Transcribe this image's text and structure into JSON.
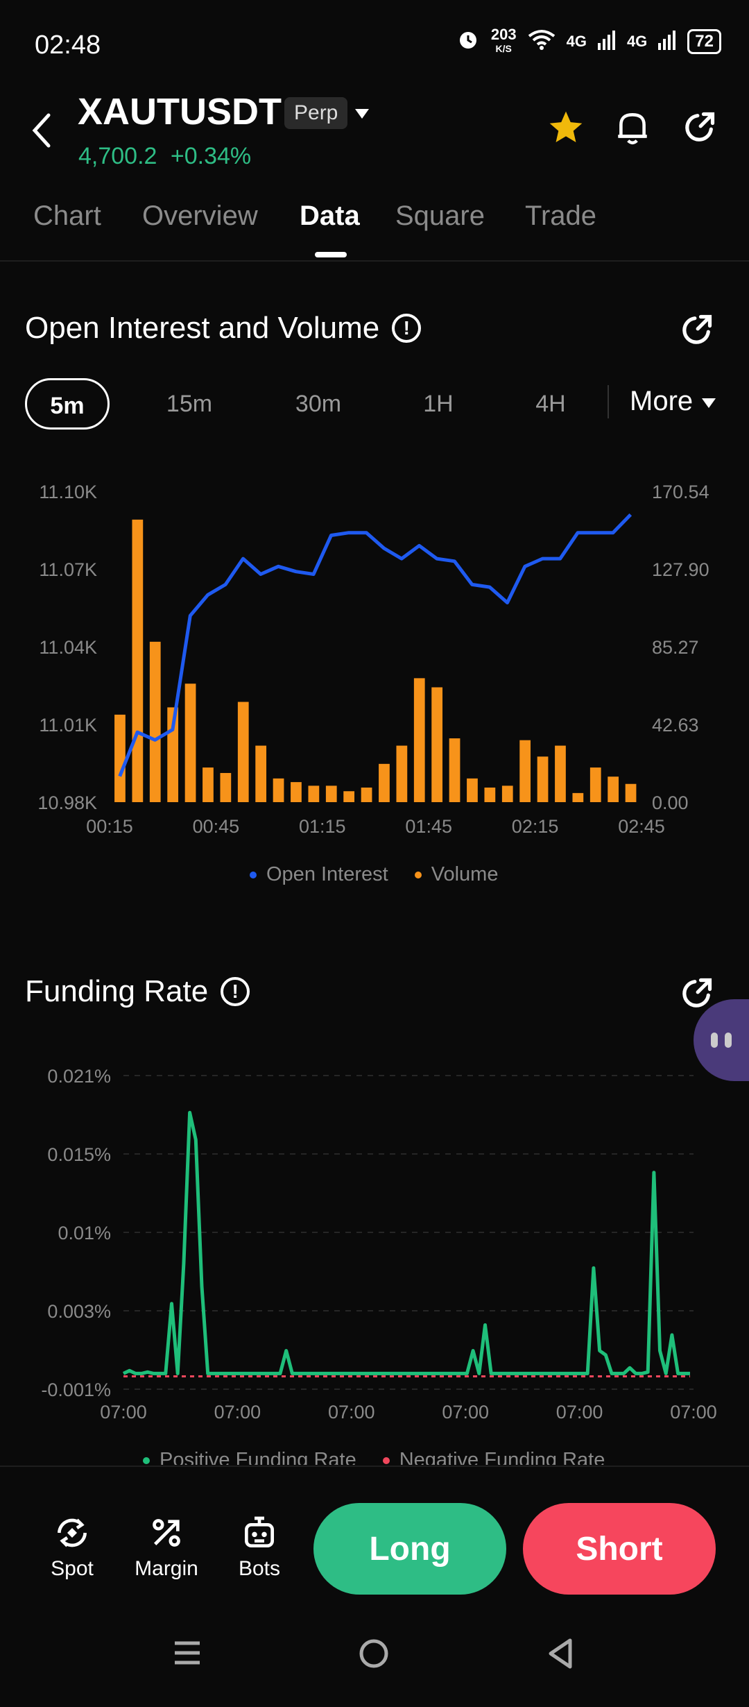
{
  "status": {
    "time": "02:48",
    "speed_top": "203",
    "speed_bottom": "K/S",
    "net1": "4G",
    "net2": "4G",
    "battery": "72"
  },
  "header": {
    "symbol": "XAUTUSDT",
    "badge": "Perp",
    "price": "4,700.2",
    "change": "+0.34%"
  },
  "tabs": [
    "Chart",
    "Overview",
    "Data",
    "Square",
    "Trade"
  ],
  "active_tab": "Data",
  "oi_section": {
    "title": "Open Interest and Volume",
    "intervals": [
      "5m",
      "15m",
      "30m",
      "1H",
      "4H"
    ],
    "active_interval": "5m",
    "more_label": "More"
  },
  "chart_data": [
    {
      "type": "bar+line",
      "x_ticks": [
        "00:15",
        "00:45",
        "01:15",
        "01:45",
        "02:15",
        "02:45"
      ],
      "left_axis_ticks": [
        "11.10K",
        "11.07K",
        "11.04K",
        "11.01K",
        "10.98K"
      ],
      "right_axis_ticks": [
        "170.54",
        "127.90",
        "85.27",
        "42.63",
        "0.00"
      ],
      "ylim_left": [
        10980,
        11100
      ],
      "ylim_right": [
        0,
        170.54
      ],
      "series": [
        {
          "name": "Open Interest",
          "axis": "left",
          "color": "#1f5af0",
          "values": [
            10990,
            11007,
            11004,
            11008,
            11052,
            11060,
            11064,
            11074,
            11068,
            11071,
            11069,
            11068,
            11083,
            11084,
            11084,
            11078,
            11074,
            11079,
            11074,
            11073,
            11064,
            11063,
            11057,
            11071,
            11074,
            11074,
            11084,
            11084,
            11084,
            11091
          ]
        },
        {
          "name": "Volume",
          "axis": "right",
          "color": "#f7931a",
          "values": [
            48,
            155,
            88,
            52,
            65,
            19,
            16,
            55,
            31,
            13,
            11,
            9,
            9,
            6,
            8,
            21,
            31,
            68,
            63,
            35,
            13,
            8,
            9,
            34,
            25,
            31,
            5,
            19,
            14,
            10
          ]
        }
      ]
    },
    {
      "type": "line",
      "x_ticks": [
        "07:00",
        "07:00",
        "07:00",
        "07:00",
        "07:00",
        "07:00"
      ],
      "y_ticks": [
        "0.021%",
        "0.015%",
        "0.01%",
        "0.003%",
        "-0.001%"
      ],
      "ylim": [
        -0.001,
        0.021
      ],
      "series": [
        {
          "name": "Positive Funding Rate",
          "color": "#1fbf7a",
          "values": [
            0.0001,
            0.0003,
            0.0001,
            0.0001,
            0.0002,
            0.0001,
            0.0001,
            0.0001,
            0.005,
            0.0001,
            0.0078,
            0.0184,
            0.0165,
            0.0062,
            0.0001,
            0.0001,
            0.0001,
            0.0001,
            0.0001,
            0.0001,
            0.0001,
            0.0001,
            0.0001,
            0.0001,
            0.0001,
            0.0001,
            0.0001,
            0.0017,
            0.0001,
            0.0001,
            0.0001,
            0.0001,
            0.0001,
            0.0001,
            0.0001,
            0.0001,
            0.0001,
            0.0001,
            0.0001,
            0.0001,
            0.0001,
            0.0001,
            0.0001,
            0.0001,
            0.0001,
            0.0001,
            0.0001,
            0.0001,
            0.0001,
            0.0001,
            0.0001,
            0.0001,
            0.0001,
            0.0001,
            0.0001,
            0.0001,
            0.0001,
            0.0001,
            0.0017,
            0.0001,
            0.0035,
            0.0001,
            0.0001,
            0.0001,
            0.0001,
            0.0001,
            0.0001,
            0.0001,
            0.0001,
            0.0001,
            0.0001,
            0.0001,
            0.0001,
            0.0001,
            0.0001,
            0.0001,
            0.0001,
            0.0001,
            0.0075,
            0.0017,
            0.0014,
            0.0001,
            0.0001,
            0.0001,
            0.0005,
            0.0001,
            0.0001,
            0.0002,
            0.0142,
            0.0017,
            0.0001,
            0.0028,
            0.0001,
            0.0001,
            0.0001
          ]
        },
        {
          "name": "Negative Funding Rate",
          "color": "#f0475c",
          "values": []
        }
      ]
    }
  ],
  "funding_section": {
    "title": "Funding Rate"
  },
  "bottom": {
    "spot": "Spot",
    "margin": "Margin",
    "bots": "Bots",
    "long": "Long",
    "short": "Short"
  },
  "colors": {
    "green": "#2ebd85",
    "long": "#2ebd85",
    "short": "#f6465d",
    "star": "#f0b90b"
  }
}
